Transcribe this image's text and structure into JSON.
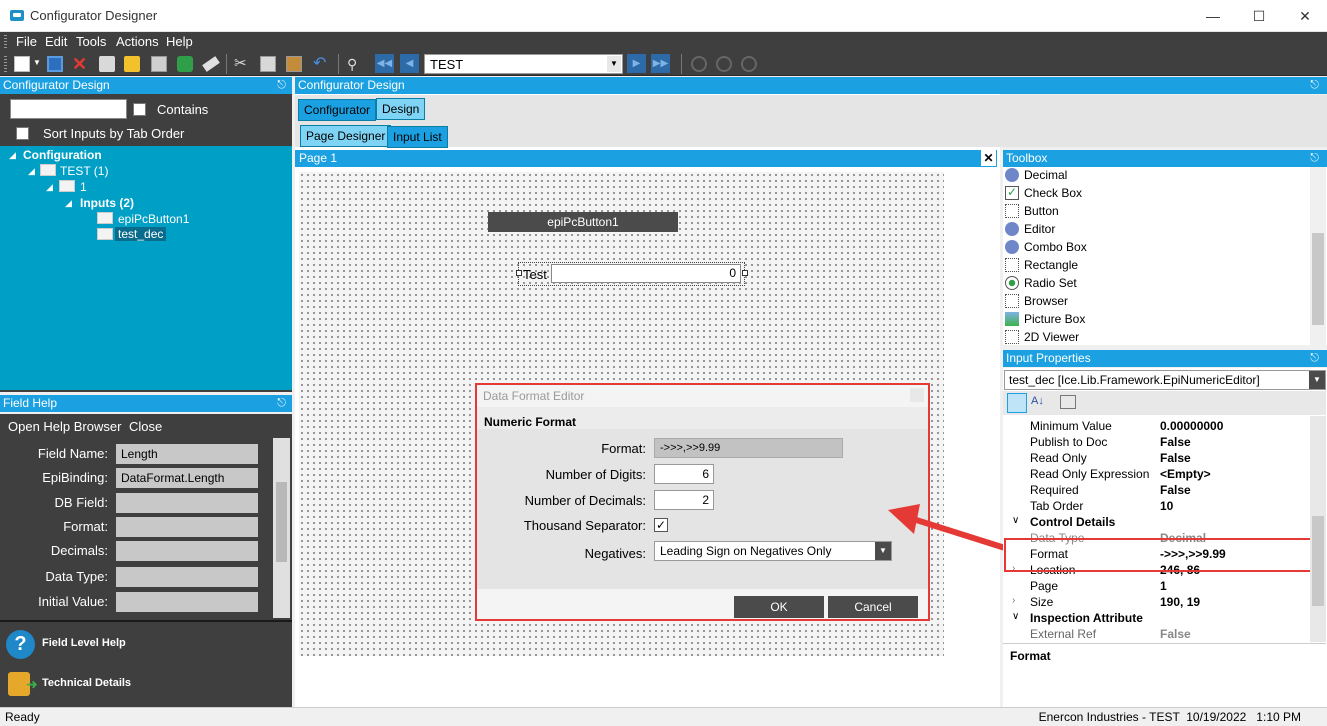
{
  "window": {
    "title": "Configurator Designer"
  },
  "menu": [
    "File",
    "Edit",
    "Tools",
    "Actions",
    "Help"
  ],
  "toolbar": {
    "combo_value": "TEST"
  },
  "left_panel": {
    "title": "Configurator Design",
    "contains_label": "Contains",
    "sort_label": "Sort Inputs by Tab Order",
    "tree": {
      "root": "Configuration",
      "test": "TEST (1)",
      "page": "1",
      "inputs": "Inputs (2)",
      "item1": "epiPcButton1",
      "item2": "test_dec"
    }
  },
  "field_help": {
    "title": "Field Help",
    "open_browser": "Open Help Browser",
    "close": "Close",
    "rows": [
      {
        "label": "Field Name:",
        "value": "Length"
      },
      {
        "label": "EpiBinding:",
        "value": "DataFormat.Length"
      },
      {
        "label": "DB Field:",
        "value": ""
      },
      {
        "label": "Format:",
        "value": ""
      },
      {
        "label": "Decimals:",
        "value": ""
      },
      {
        "label": "Data Type:",
        "value": ""
      },
      {
        "label": "Initial Value:",
        "value": ""
      }
    ],
    "footer1": "Field Level Help",
    "footer2": "Technical Details"
  },
  "center": {
    "title": "Configurator Design",
    "tabs": [
      "Configurator",
      "Design"
    ],
    "subtabs": [
      "Page Designer",
      "Input List"
    ],
    "page_title": "Page 1",
    "button_label": "epiPcButton1",
    "test_label": "Test",
    "test_value": "0"
  },
  "dialog": {
    "title": "Data Format Editor",
    "section": "Numeric Format",
    "format_label": "Format:",
    "format_value": "->>>,>>9.99",
    "digits_label": "Number of Digits:",
    "digits_value": "6",
    "decimals_label": "Number of Decimals:",
    "decimals_value": "2",
    "thousand_label": "Thousand Separator:",
    "thousand_checked": true,
    "negatives_label": "Negatives:",
    "negatives_value": "Leading Sign on Negatives Only",
    "ok": "OK",
    "cancel": "Cancel"
  },
  "toolbox": {
    "title": "Toolbox",
    "items": [
      "Decimal",
      "Check Box",
      "Button",
      "Editor",
      "Combo Box",
      "Rectangle",
      "Radio Set",
      "Browser",
      "Picture Box",
      "2D Viewer"
    ]
  },
  "props": {
    "title": "Input Properties",
    "object": "test_dec [Ice.Lib.Framework.EpiNumericEditor]",
    "rows": [
      {
        "label": "Minimum Value",
        "value": "0.00000000"
      },
      {
        "label": "Publish to Doc",
        "value": "False"
      },
      {
        "label": "Read Only",
        "value": "False"
      },
      {
        "label": "Read Only Expression",
        "value": "<Empty>"
      },
      {
        "label": "Required",
        "value": "False"
      },
      {
        "label": "Tab Order",
        "value": "10"
      }
    ],
    "cat1": "Control Details",
    "rows2": [
      {
        "label": "Data Type",
        "value": "Decimal"
      },
      {
        "label": "Format",
        "value": "->>>,>>9.99"
      },
      {
        "label": "Location",
        "value": "246, 86"
      },
      {
        "label": "Page",
        "value": "1"
      },
      {
        "label": "Size",
        "value": "190, 19"
      }
    ],
    "cat2": "Inspection Attribute",
    "rows3": [
      {
        "label": "External Ref",
        "value": "False"
      }
    ],
    "desc_title": "Format"
  },
  "status": {
    "left": "Ready",
    "right": "Enercon Industries - TEST  10/19/2022   1:10 PM"
  },
  "colors": {
    "accent": "#1ba1e2",
    "tree_bg": "#00a0c6",
    "highlight_red": "#e53935"
  }
}
